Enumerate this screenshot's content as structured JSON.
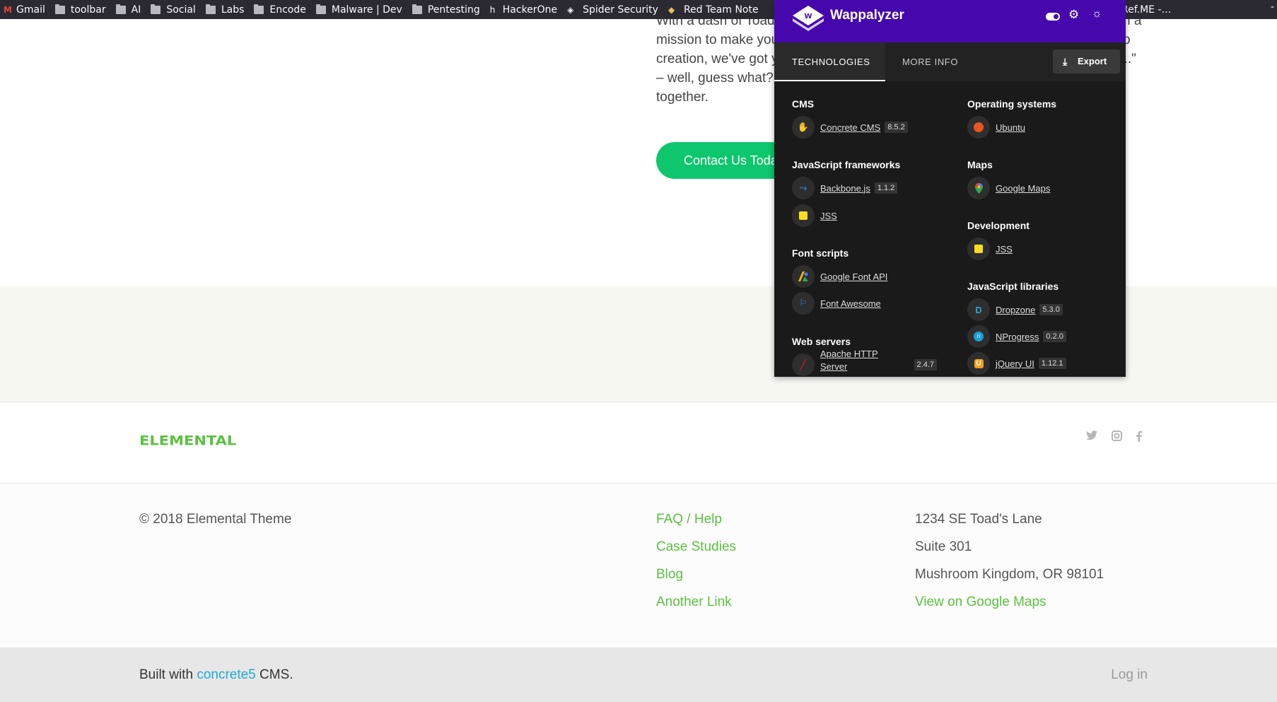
{
  "bookmarks": {
    "items": [
      {
        "label": "Gmail",
        "icon": "gmail-icon"
      },
      {
        "label": "toolbar",
        "icon": "folder-icon"
      },
      {
        "label": "AI",
        "icon": "folder-icon"
      },
      {
        "label": "Social",
        "icon": "folder-icon"
      },
      {
        "label": "Labs",
        "icon": "folder-icon"
      },
      {
        "label": "Encode",
        "icon": "folder-icon"
      },
      {
        "label": "Malware | Dev",
        "icon": "folder-icon"
      },
      {
        "label": "Pentesting",
        "icon": "folder-icon"
      },
      {
        "label": "HackerOne",
        "icon": "hackerone-icon"
      },
      {
        "label": "Spider Security",
        "icon": "spider-icon"
      },
      {
        "label": "Red Team Note",
        "icon": "redteam-icon"
      }
    ],
    "right_label": "Ref.ME -…",
    "close_label": "-"
  },
  "page": {
    "intro_lines": [
      "With a dash of Toad",
      "mission to make you",
      "creation, we've got y",
      "– well, guess what?",
      "together."
    ],
    "intro_right_fragments": [
      "n a",
      "o",
      "f...\""
    ],
    "cta_label": "Contact Us Toda",
    "logo_text": "ELEMENTAL",
    "copyright": "© 2018 Elemental Theme",
    "footer_links": [
      "FAQ / Help",
      "Case Studies",
      "Blog",
      "Another Link"
    ],
    "address_lines": [
      "1234 SE Toad's Lane",
      "Suite 301",
      "Mushroom Kingdom, OR 98101"
    ],
    "map_link": "View on Google Maps",
    "built_prefix": "Built with ",
    "built_link": "concrete5",
    "built_suffix": " CMS.",
    "login_label": "Log in"
  },
  "wappalyzer": {
    "title": "Wappalyzer",
    "tabs": [
      "TECHNOLOGIES",
      "MORE INFO"
    ],
    "export_label": "Export",
    "colors": {
      "header": "#4608ad",
      "panel": "#1a1a1a"
    },
    "left_categories": [
      {
        "name": "CMS",
        "techs": [
          {
            "name": "Concrete CMS",
            "version": "8.5.2",
            "icon": "concrete-icon"
          }
        ]
      },
      {
        "name": "JavaScript frameworks",
        "techs": [
          {
            "name": "Backbone.js",
            "version": "1.1.2",
            "icon": "backbone-icon"
          },
          {
            "name": "JSS",
            "version": "",
            "icon": "jss-icon"
          }
        ]
      },
      {
        "name": "Font scripts",
        "techs": [
          {
            "name": "Google Font API",
            "version": "",
            "icon": "google-font-icon"
          },
          {
            "name": "Font Awesome",
            "version": "",
            "icon": "font-awesome-icon"
          }
        ]
      },
      {
        "name": "Web servers",
        "techs": [
          {
            "name": "Apache HTTP Server",
            "version": "2.4.7",
            "icon": "apache-icon"
          }
        ]
      }
    ],
    "right_categories": [
      {
        "name": "Operating systems",
        "techs": [
          {
            "name": "Ubuntu",
            "version": "",
            "icon": "ubuntu-icon"
          }
        ]
      },
      {
        "name": "Maps",
        "techs": [
          {
            "name": "Google Maps",
            "version": "",
            "icon": "google-maps-icon"
          }
        ]
      },
      {
        "name": "Development",
        "techs": [
          {
            "name": "JSS",
            "version": "",
            "icon": "jss-icon"
          }
        ]
      },
      {
        "name": "JavaScript libraries",
        "techs": [
          {
            "name": "Dropzone",
            "version": "5.3.0",
            "icon": "dropzone-icon"
          },
          {
            "name": "NProgress",
            "version": "0.2.0",
            "icon": "nprogress-icon"
          },
          {
            "name": "jQuery UI",
            "version": "1.12.1",
            "icon": "jquery-ui-icon"
          }
        ]
      }
    ]
  }
}
